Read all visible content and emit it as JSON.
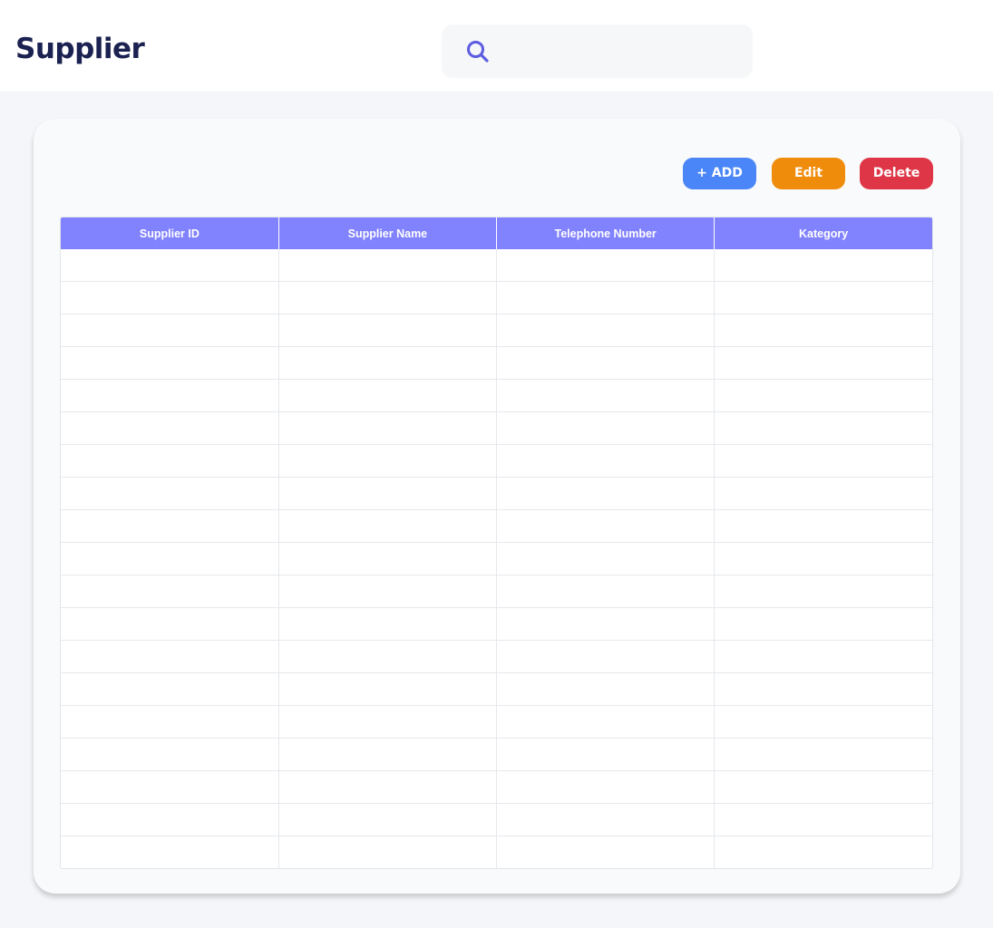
{
  "header": {
    "title": "Supplier",
    "search": {
      "placeholder": "",
      "value": "",
      "icon": "search-icon"
    }
  },
  "toolbar": {
    "add_label": "+ ADD",
    "edit_label": "Edit",
    "delete_label": "Delete"
  },
  "colors": {
    "title": "#1b2150",
    "add": "#4a86f7",
    "edit": "#f08c0b",
    "delete": "#de3647",
    "table_header": "#8182fd",
    "search_icon": "#5b5ce0"
  },
  "table": {
    "columns": [
      "Supplier ID",
      "Supplier Name",
      "Telephone Number",
      "Kategory"
    ],
    "rows": [
      [
        "",
        "",
        "",
        ""
      ],
      [
        "",
        "",
        "",
        ""
      ],
      [
        "",
        "",
        "",
        ""
      ],
      [
        "",
        "",
        "",
        ""
      ],
      [
        "",
        "",
        "",
        ""
      ],
      [
        "",
        "",
        "",
        ""
      ],
      [
        "",
        "",
        "",
        ""
      ],
      [
        "",
        "",
        "",
        ""
      ],
      [
        "",
        "",
        "",
        ""
      ],
      [
        "",
        "",
        "",
        ""
      ],
      [
        "",
        "",
        "",
        ""
      ],
      [
        "",
        "",
        "",
        ""
      ],
      [
        "",
        "",
        "",
        ""
      ],
      [
        "",
        "",
        "",
        ""
      ],
      [
        "",
        "",
        "",
        ""
      ],
      [
        "",
        "",
        "",
        ""
      ],
      [
        "",
        "",
        "",
        ""
      ],
      [
        "",
        "",
        "",
        ""
      ],
      [
        "",
        "",
        "",
        ""
      ]
    ]
  }
}
